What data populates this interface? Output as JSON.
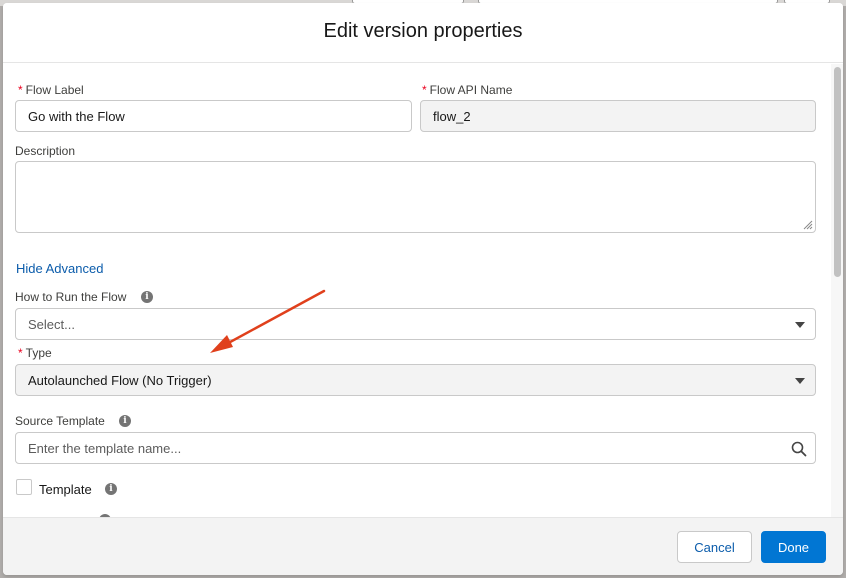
{
  "modal": {
    "title": "Edit version properties"
  },
  "fields": {
    "flow_label": {
      "label": "Flow Label",
      "value": "Go with the Flow",
      "required": "*"
    },
    "flow_api_name": {
      "label": "Flow API Name",
      "value": "flow_2",
      "required": "*"
    },
    "description": {
      "label": "Description",
      "value": ""
    },
    "advanced_toggle": "Hide Advanced",
    "how_to_run": {
      "label": "How to Run the Flow",
      "value": "Select..."
    },
    "type": {
      "label": "Type",
      "value": "Autolaunched Flow (No Trigger)",
      "required": "*"
    },
    "source_template": {
      "label": "Source Template",
      "placeholder": "Enter the template name..."
    },
    "template": {
      "label": "Template"
    }
  },
  "icons": {
    "info": "i"
  },
  "footer": {
    "cancel_label": "Cancel",
    "done_label": "Done"
  },
  "colors": {
    "brand": "#0176d3",
    "link": "#0b5cab",
    "required": "#ea001e",
    "annotation_arrow": "#e0401c"
  }
}
